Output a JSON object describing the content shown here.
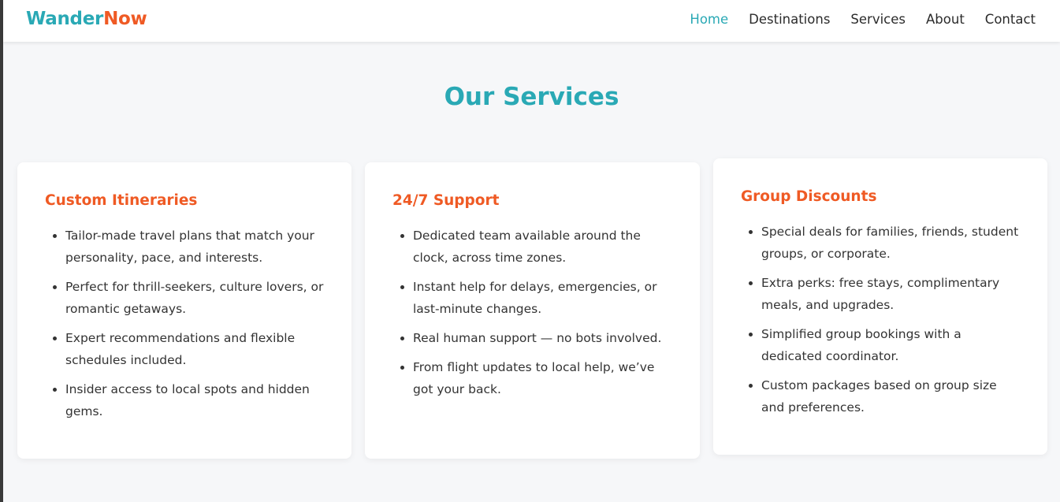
{
  "nav": {
    "brand_part1": "Wander",
    "brand_part2": "Now",
    "links": [
      "Home",
      "Destinations",
      "Services",
      "About",
      "Contact"
    ],
    "active": "Home"
  },
  "colors": {
    "accent": "#2aa9b5",
    "orange": "#ef5a24",
    "background": "#f6f7f9",
    "text": "#333333"
  },
  "main": {
    "title": "Our Services",
    "cards": [
      {
        "title": "Custom Itineraries",
        "items": [
          "Tailor-made travel plans that match your personality, pace, and interests.",
          "Perfect for thrill-seekers, culture lovers, or romantic getaways.",
          "Expert recommendations and flexible schedules included.",
          "Insider access to local spots and hidden gems."
        ]
      },
      {
        "title": "24/7 Support",
        "items": [
          "Dedicated team available around the clock, across time zones.",
          "Instant help for delays, emergencies, or last-minute changes.",
          "Real human support — no bots involved.",
          "From flight updates to local help, we’ve got your back."
        ]
      },
      {
        "title": "Group Discounts",
        "items": [
          "Special deals for families, friends, student groups, or corporate.",
          "Extra perks: free stays, complimentary meals, and upgrades.",
          "Simplified group bookings with a dedicated coordinator.",
          "Custom packages based on group size and preferences."
        ]
      }
    ]
  }
}
